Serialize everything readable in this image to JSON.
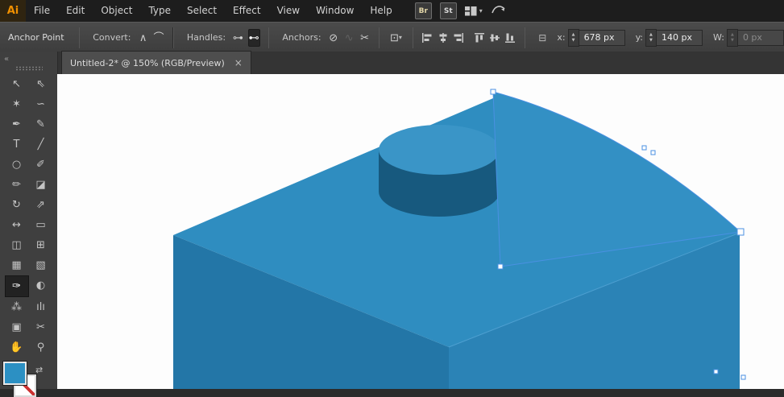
{
  "app_icon": "Ai",
  "menubar": {
    "items": [
      "File",
      "Edit",
      "Object",
      "Type",
      "Select",
      "Effect",
      "View",
      "Window",
      "Help"
    ]
  },
  "quick_icons": {
    "bridge": "Br",
    "stock": "St"
  },
  "control_bar": {
    "title": "Anchor Point",
    "convert_label": "Convert:",
    "handles_label": "Handles:",
    "anchors_label": "Anchors:",
    "x_label": "x:",
    "x_value": "678 px",
    "y_label": "y:",
    "y_value": "140 px",
    "w_label": "W:",
    "w_value": "0 px"
  },
  "icons": {
    "convert_corner": "∧",
    "convert_smooth": "⌒",
    "handles_show": "⊶",
    "handles_hide": "⊷",
    "anchors_remove": "⊘",
    "anchors_connect": "∿",
    "anchors_cut": "✂",
    "isolate": "⊡",
    "caret": "▾",
    "reference": "⊟",
    "swap": "⇄",
    "stepper_up": "▲",
    "stepper_down": "▼",
    "collapse": "«",
    "tab_close": "×"
  },
  "tab": {
    "title": "Untitled-2* @ 150% (RGB/Preview)"
  },
  "toolbar": {
    "tools": [
      {
        "name": "selection-tool",
        "glyph": "↖"
      },
      {
        "name": "direct-selection-tool",
        "glyph": "⇖"
      },
      {
        "name": "magic-wand-tool",
        "glyph": "✶"
      },
      {
        "name": "lasso-tool",
        "glyph": "∽"
      },
      {
        "name": "pen-tool",
        "glyph": "✒"
      },
      {
        "name": "curvature-tool",
        "glyph": "✎"
      },
      {
        "name": "type-tool",
        "glyph": "T"
      },
      {
        "name": "line-tool",
        "glyph": "╱"
      },
      {
        "name": "ellipse-tool",
        "glyph": "○"
      },
      {
        "name": "paintbrush-tool",
        "glyph": "✐"
      },
      {
        "name": "pencil-tool",
        "glyph": "✏"
      },
      {
        "name": "eraser-tool",
        "glyph": "◪"
      },
      {
        "name": "rotate-tool",
        "glyph": "↻"
      },
      {
        "name": "scale-tool",
        "glyph": "⇗"
      },
      {
        "name": "width-tool",
        "glyph": "↔"
      },
      {
        "name": "free-transform-tool",
        "glyph": "▭"
      },
      {
        "name": "shape-builder-tool",
        "glyph": "◫"
      },
      {
        "name": "perspective-grid-tool",
        "glyph": "⊞"
      },
      {
        "name": "mesh-tool",
        "glyph": "▦"
      },
      {
        "name": "gradient-tool",
        "glyph": "▧"
      },
      {
        "name": "eyedropper-tool",
        "glyph": "✑",
        "active": true
      },
      {
        "name": "blend-tool",
        "glyph": "◐"
      },
      {
        "name": "symbol-sprayer-tool",
        "glyph": "⁂"
      },
      {
        "name": "column-graph-tool",
        "glyph": "ılı"
      },
      {
        "name": "artboard-tool",
        "glyph": "▣"
      },
      {
        "name": "slice-tool",
        "glyph": "✂"
      },
      {
        "name": "hand-tool",
        "glyph": "✋"
      },
      {
        "name": "zoom-tool",
        "glyph": "⚲"
      }
    ]
  },
  "canvas": {
    "colors": {
      "cube_top": "#2f8dc0",
      "cube_left": "#2376a7",
      "cube_right": "#2b83b6",
      "cylinder_side": "#17597e",
      "cylinder_top": "#3a95c7",
      "selected_shape": "#3390c4",
      "selection_accent": "#4a90e2",
      "fill_swatch": "#2c90c3"
    }
  }
}
